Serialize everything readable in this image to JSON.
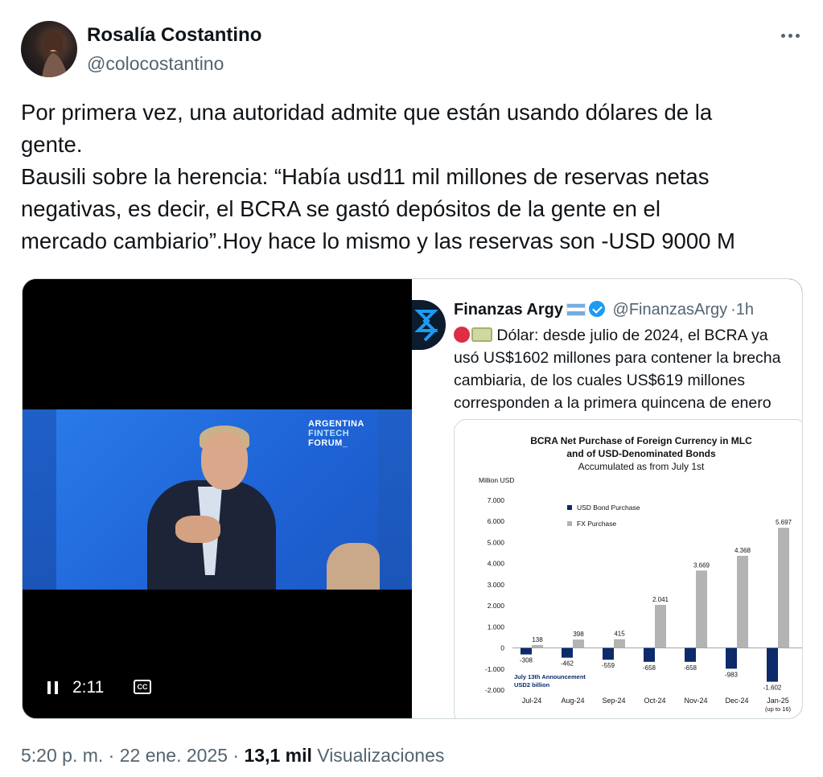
{
  "author": {
    "name": "Rosalía Costantino",
    "handle": "@colocostantino"
  },
  "tweet": {
    "lines": [
      "Por primera vez, una autoridad admite que están usando dólares de la",
      "gente.",
      "Bausili sobre la herencia: “Había usd11 mil millones de reservas netas",
      "negativas, es decir, el BCRA se gastó depósitos de la gente en el",
      "mercado cambiario”.Hoy hace lo mismo y las reservas son -USD 9000 M"
    ]
  },
  "video": {
    "time": "2:11",
    "cc_label": "CC",
    "logo_lines": [
      "ARGENTINA",
      "FINTECH",
      "FORUM_"
    ]
  },
  "embedded_tweet": {
    "name": "Finanzas Argy",
    "handle": "@FinanzasArgy",
    "time": "1h",
    "lines": [
      "Dólar: desde julio de 2024, el BCRA ya",
      "usó US$1602 millones para contener la brecha",
      "cambiaria, de los cuales US$619 millones",
      "corresponden a la primera quincena de enero"
    ]
  },
  "chart_data": {
    "type": "bar",
    "title": "BCRA Net Purchase of Foreign Currency in MLC",
    "title_line2": "and of USD-Denominated Bonds",
    "subtitle": "Accumulated as from July 1st",
    "ylabel": "Million USD",
    "ylim": [
      -2000,
      7000
    ],
    "yticks": [
      "7.000",
      "6.000",
      "5.000",
      "4.000",
      "3.000",
      "2.000",
      "1.000",
      "0",
      "-1.000",
      "-2.000"
    ],
    "yticks_values": [
      7000,
      6000,
      5000,
      4000,
      3000,
      2000,
      1000,
      0,
      -1000,
      -2000
    ],
    "categories": [
      "Jul-24",
      "Aug-24",
      "Sep-24",
      "Oct-24",
      "Nov-24",
      "Dec-24",
      "Jan-25"
    ],
    "category_note": "(up to 16)",
    "series": [
      {
        "name": "USD Bond Purchase",
        "color": "#0d2a6b",
        "values": [
          -308,
          -462,
          -559,
          -658,
          -658,
          -983,
          -1602
        ],
        "labels": [
          "-308",
          "-462",
          "-559",
          "-658",
          "-658",
          "-983",
          "-1.602"
        ]
      },
      {
        "name": "FX Purchase",
        "color": "#b3b3b3",
        "values": [
          138,
          398,
          415,
          2041,
          3669,
          4368,
          5697
        ],
        "labels": [
          "138",
          "398",
          "415",
          "2.041",
          "3.669",
          "4.368",
          "5.697"
        ]
      }
    ],
    "annotation": [
      "July 13th Announcement",
      "USD2 billion"
    ],
    "legend_position": "top-left"
  },
  "footer": {
    "time": "5:20 p. m.",
    "sep1": "·",
    "date": "22 ene. 2025",
    "sep2": "·",
    "views_count": "13,1 mil",
    "views_label": "Visualizaciones"
  }
}
